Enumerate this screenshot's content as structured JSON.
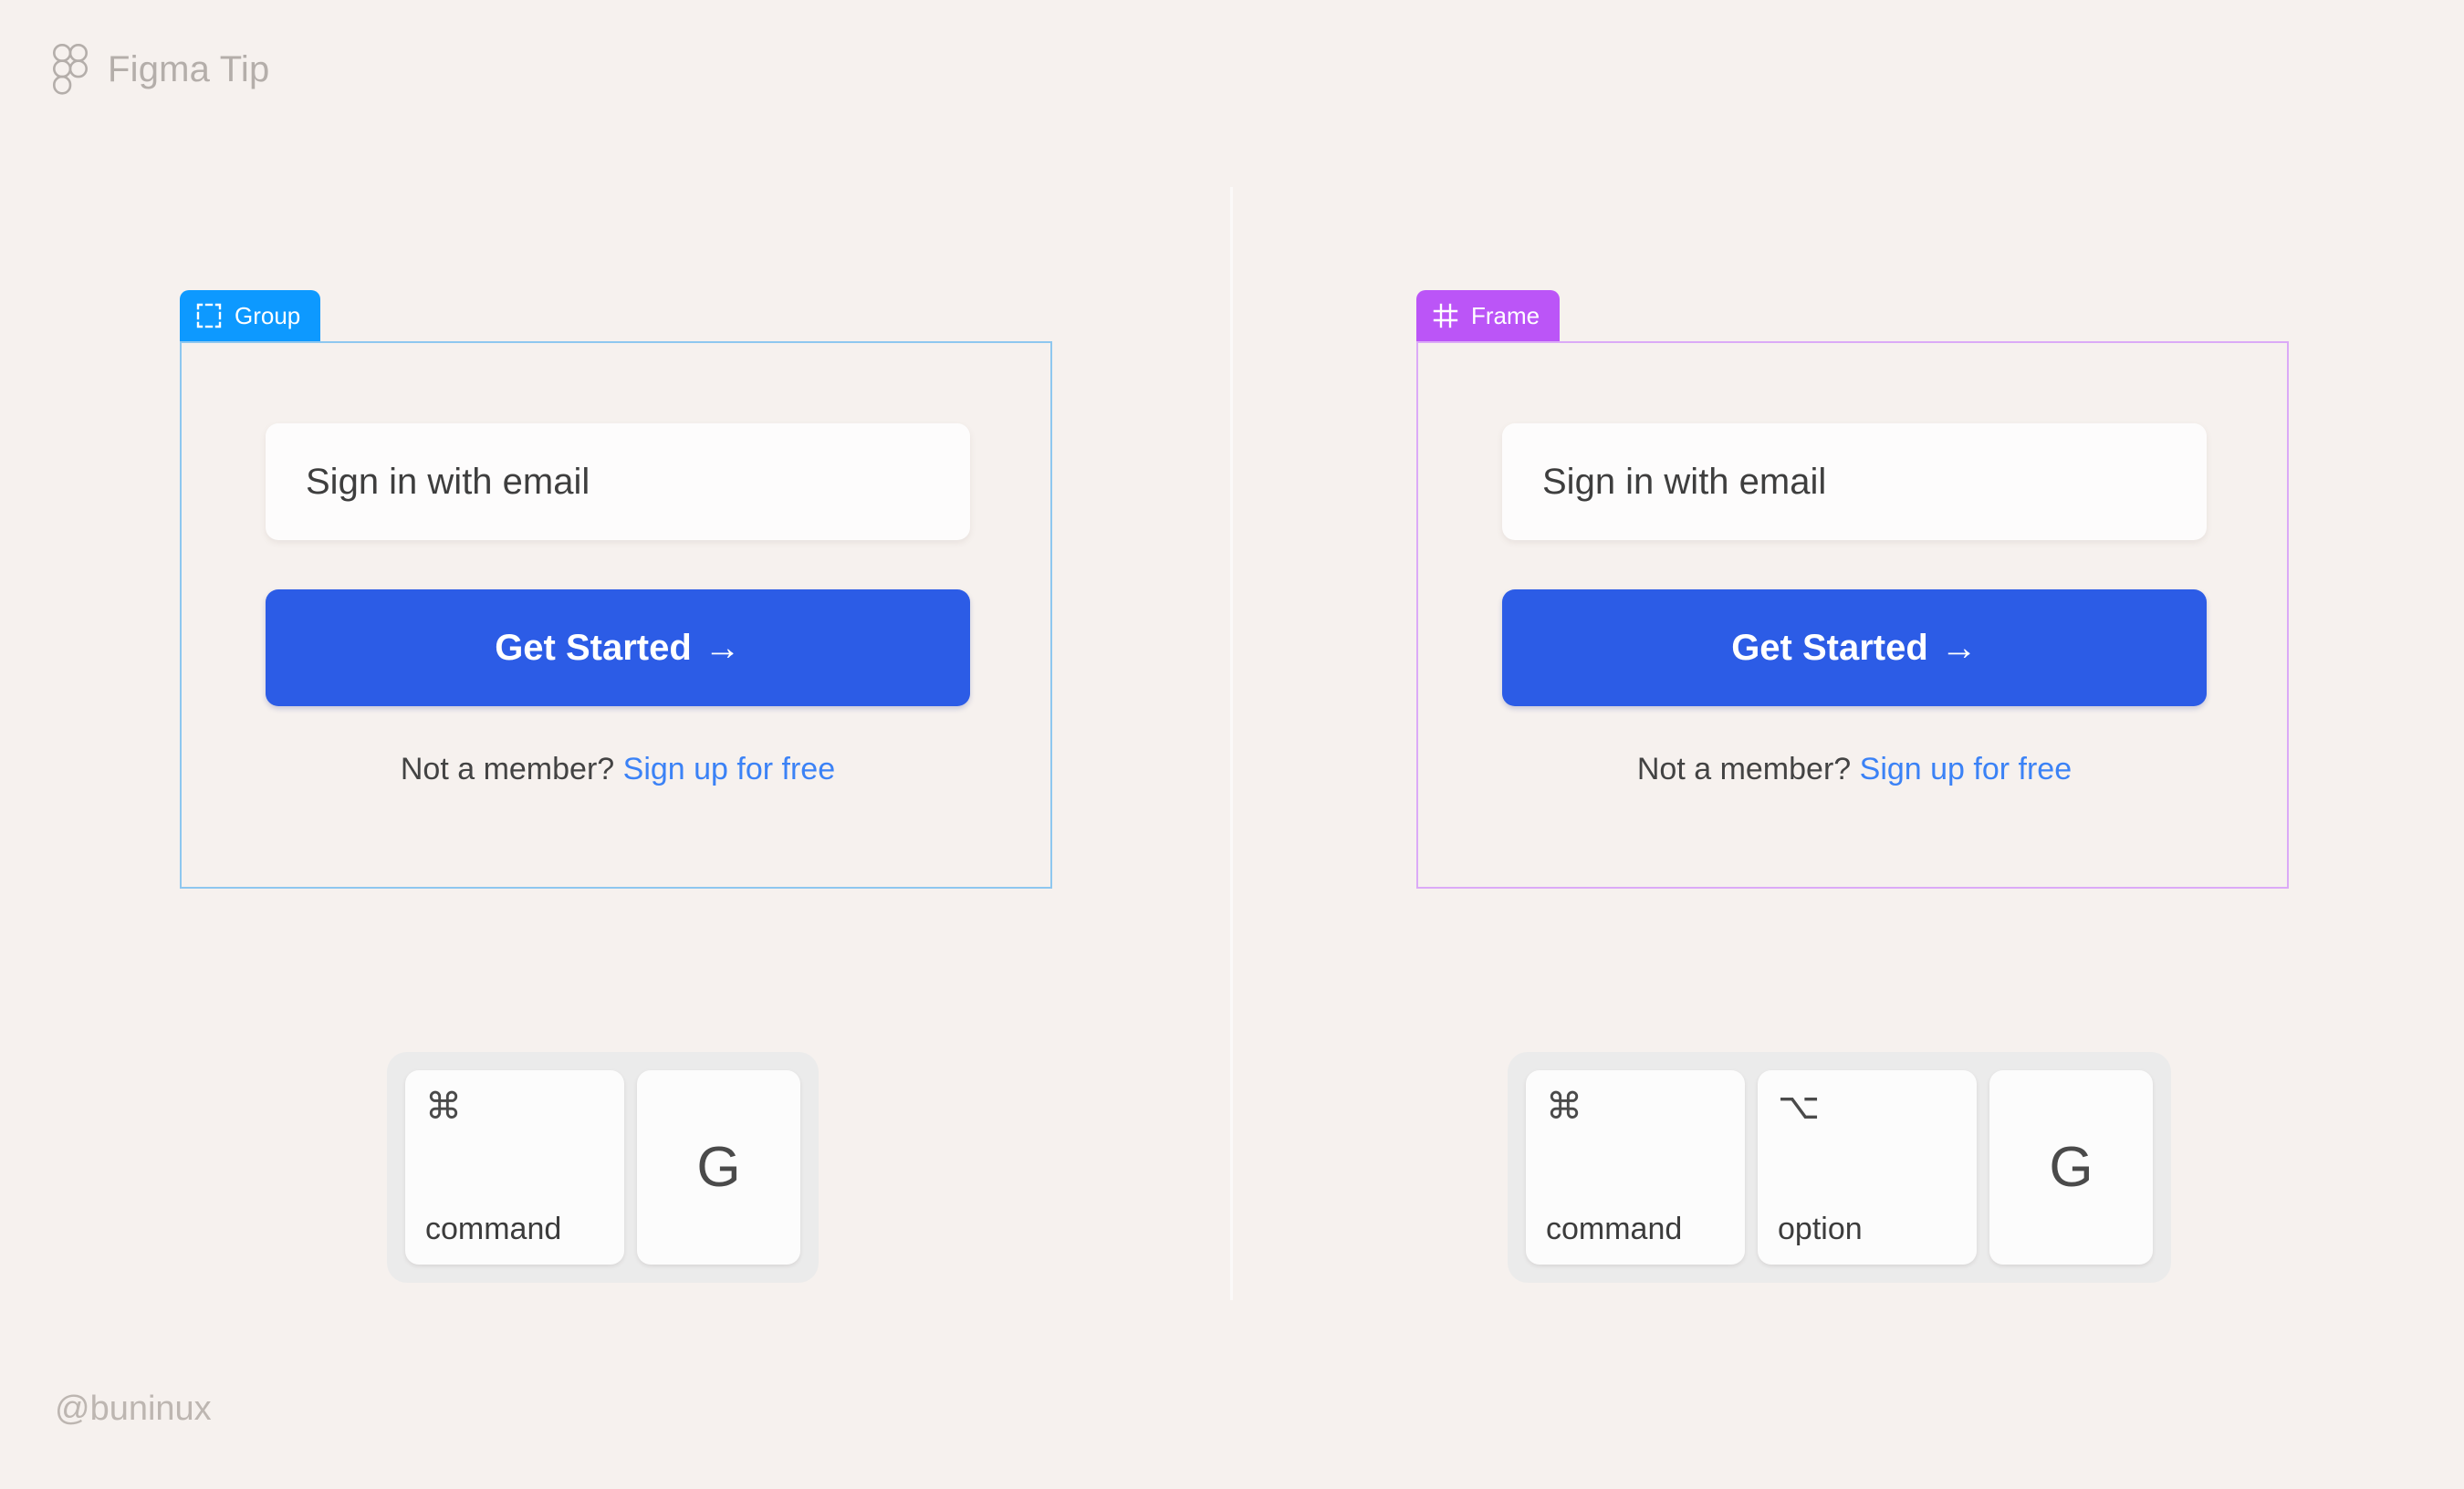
{
  "page": {
    "background_color": "#f6f1ee",
    "watermark": "@buninux"
  },
  "header": {
    "logo_icon": "figma-logo-icon",
    "title": "Figma Tip"
  },
  "panels": [
    {
      "id": "group",
      "badge": {
        "label": "Group",
        "icon": "dashed-selection-square-icon",
        "background_color": "#0d99ff"
      },
      "card": {
        "border_color": "#8ec7ef"
      },
      "form": {
        "email_field_value": "Sign in with email",
        "email_field_placeholder": "Sign in with email",
        "cta_label": "Get Started",
        "cta_arrow": "→",
        "cta_color": "#2c5ce6",
        "member_question": "Not a member?",
        "member_link": "Sign up for free",
        "member_link_color": "#3b82f6"
      },
      "shortcut": {
        "keys": [
          {
            "glyph": "⌘",
            "name": "command",
            "type": "wide"
          },
          {
            "glyph": "G",
            "name": "",
            "type": "square"
          }
        ]
      }
    },
    {
      "id": "frame",
      "badge": {
        "label": "Frame",
        "icon": "frame-hash-icon",
        "background_color": "#bb55f7"
      },
      "card": {
        "border_color": "#dbaaf7"
      },
      "form": {
        "email_field_value": "Sign in with email",
        "email_field_placeholder": "Sign in with email",
        "cta_label": "Get Started",
        "cta_arrow": "→",
        "cta_color": "#2c5ce6",
        "member_question": "Not a member?",
        "member_link": "Sign up for free",
        "member_link_color": "#3b82f6"
      },
      "shortcut": {
        "keys": [
          {
            "glyph": "⌘",
            "name": "command",
            "type": "wide"
          },
          {
            "glyph": "⌥",
            "name": "option",
            "type": "wide"
          },
          {
            "glyph": "G",
            "name": "",
            "type": "square"
          }
        ]
      }
    }
  ]
}
